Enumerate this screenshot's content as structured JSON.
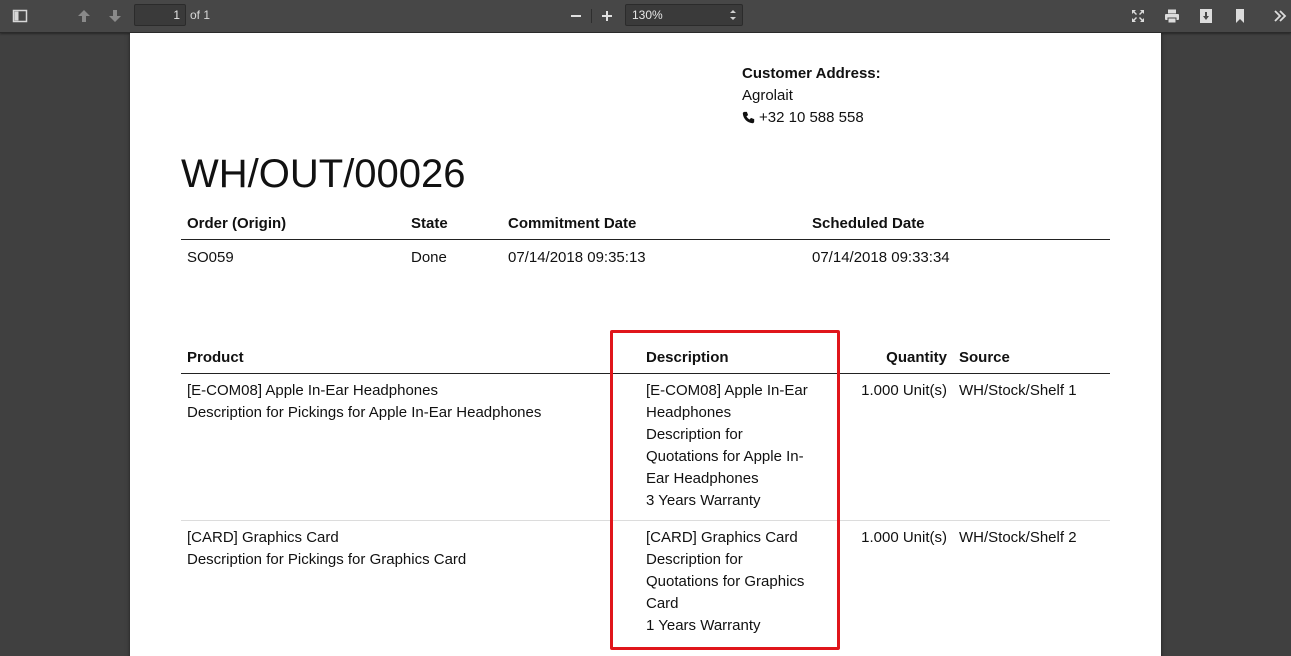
{
  "toolbar": {
    "page_number": "1",
    "page_of": "of 1",
    "zoom": "130%",
    "icons": [
      "sidebar-toggle-icon",
      "previous-page-icon",
      "next-page-icon",
      "zoom-out-icon",
      "zoom-in-icon",
      "presentation-mode-icon",
      "print-icon",
      "download-icon",
      "bookmark-icon",
      "tools-icon"
    ]
  },
  "document": {
    "customer_address_label": "Customer Address:",
    "customer_name": "Agrolait",
    "customer_phone": "+32 10 588 558",
    "title": "WH/OUT/00026",
    "info_table": {
      "headers": [
        "Order (Origin)",
        "State",
        "Commitment Date",
        "Scheduled Date"
      ],
      "row": [
        "SO059",
        "Done",
        "07/14/2018 09:35:13",
        "07/14/2018 09:33:34"
      ]
    },
    "moves_table": {
      "headers": [
        "Product",
        "Description",
        "Quantity",
        "Source"
      ],
      "rows": [
        {
          "product": [
            "[E-COM08] Apple In-Ear Headphones",
            "Description for Pickings for Apple In-Ear Headphones"
          ],
          "description": [
            "[E-COM08] Apple In-Ear",
            "Headphones",
            "Description for",
            "Quotations for Apple In-",
            "Ear Headphones",
            "3 Years Warranty"
          ],
          "quantity": "1.000 Unit(s)",
          "source": "WH/Stock/Shelf 1"
        },
        {
          "product": [
            "[CARD] Graphics Card",
            "Description for Pickings for Graphics Card"
          ],
          "description": [
            "[CARD] Graphics Card",
            "Description for",
            "Quotations for Graphics",
            "Card",
            "1 Years Warranty"
          ],
          "quantity": "1.000 Unit(s)",
          "source": "WH/Stock/Shelf 2"
        }
      ]
    }
  },
  "colors": {
    "toolbar_bg": "#474747",
    "viewer_bg": "#404040",
    "highlight": "#e0151b"
  }
}
